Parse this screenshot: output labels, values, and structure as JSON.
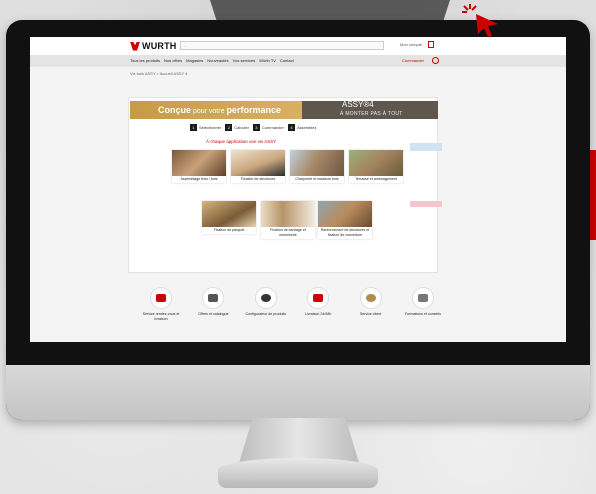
{
  "brand": {
    "name": "WURTH"
  },
  "header": {
    "search_placeholder": "...",
    "account_label": "Mon compte"
  },
  "nav": {
    "items": [
      "Tous les produits",
      "Nos offres",
      "Magasins",
      "Nouveautés",
      "Vos services",
      "Würth TV",
      "Contact"
    ],
    "right_label": "Commander"
  },
  "breadcrumb": "Vis bois ASSY > Accueil ASSY 4",
  "banner": {
    "title_bold": "Conçue",
    "title_light": " pour votre ",
    "title_bold2": "performance",
    "right_title": "ASSY®4",
    "right_sub": "À MONTER PAS À TOUT"
  },
  "steps": [
    {
      "num": "1",
      "label": "Sélectionner"
    },
    {
      "num": "2",
      "label": "Calculer"
    },
    {
      "num": "3",
      "label": "Commander"
    },
    {
      "num": "4",
      "label": "Assemblez"
    }
  ],
  "section_heading": "À chaque application une vis ASSY",
  "cards": [
    {
      "caption": "Assemblage bois / bois"
    },
    {
      "caption": "Fixation de structures"
    },
    {
      "caption": "Charpente et ossature bois"
    },
    {
      "caption": "Terrasse et aménagement"
    },
    {
      "caption": "Fixation de parquet"
    },
    {
      "caption": "Fixation de bardage et menuiserie"
    },
    {
      "caption": "Renforcement de structures et fixation de couverture"
    }
  ],
  "services": [
    {
      "label": "Service rendez-vous et livraison"
    },
    {
      "label": "Offres et catalogue"
    },
    {
      "label": "Configurateur de produits"
    },
    {
      "label": "Livraison 24/48h"
    },
    {
      "label": "Service client"
    },
    {
      "label": "Formations et conseils"
    }
  ],
  "colors": {
    "brand_red": "#cc0000",
    "banner_gold": "#c79a45",
    "banner_dark": "#5f564d"
  }
}
